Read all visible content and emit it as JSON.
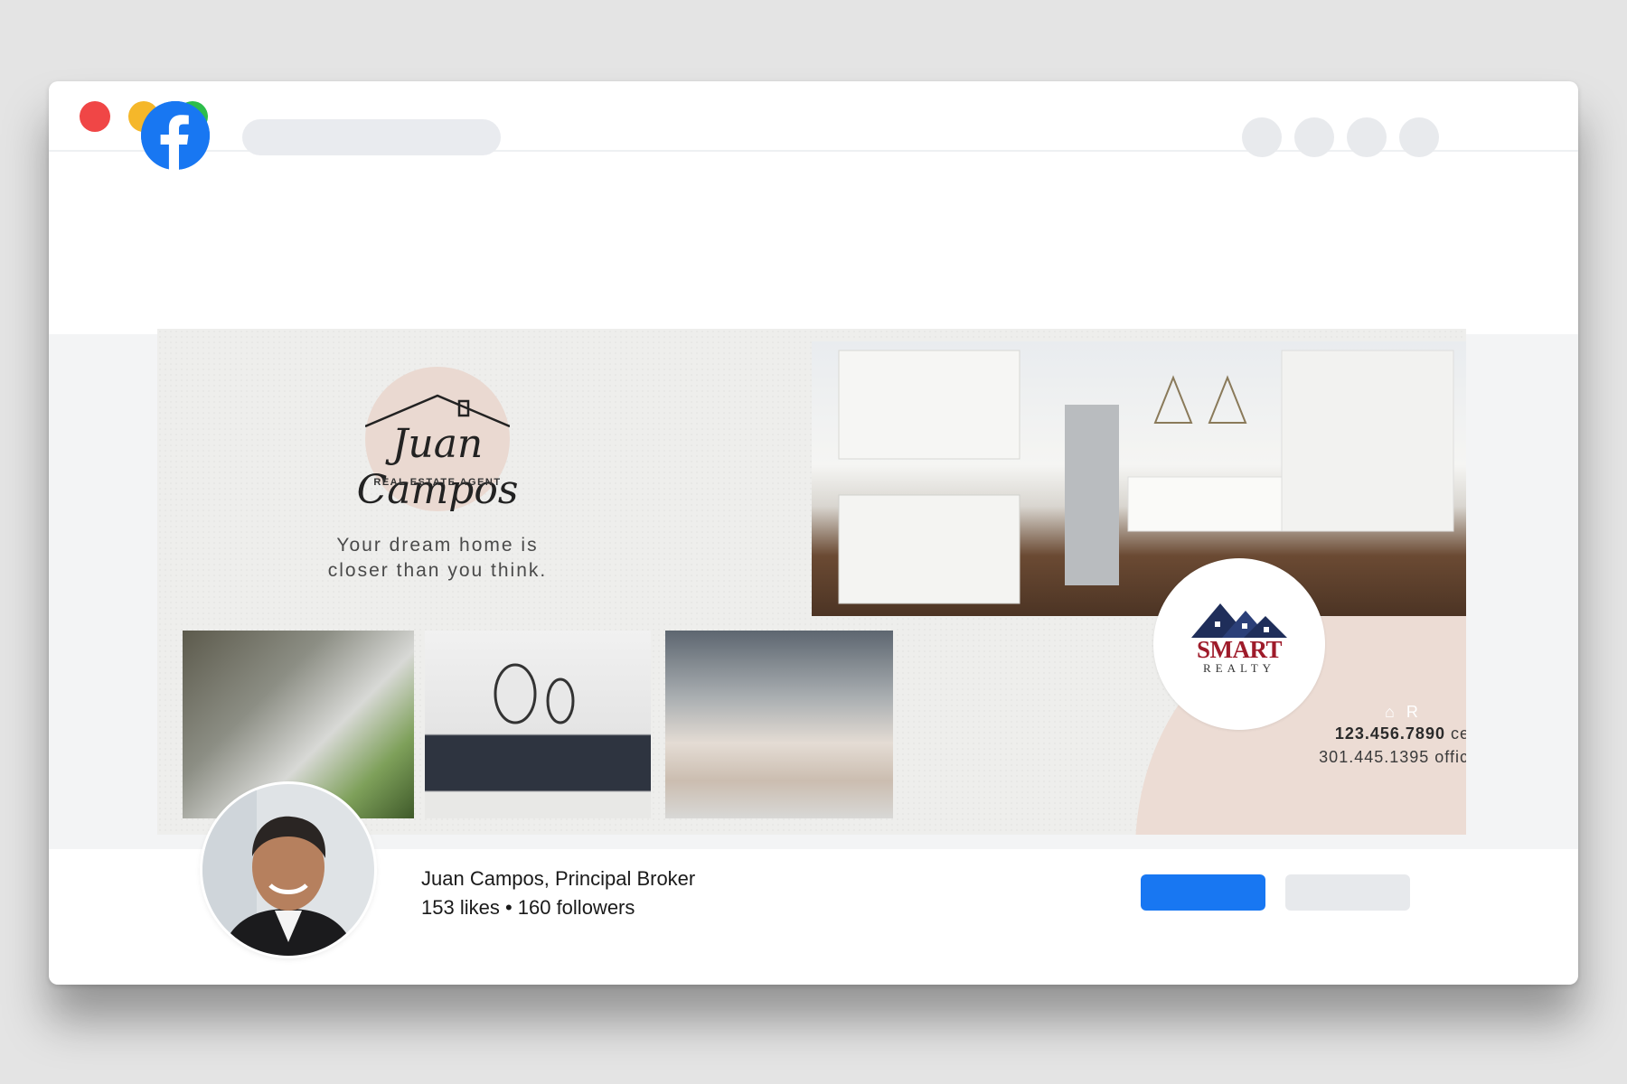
{
  "browser": {
    "controls": [
      "close",
      "minimize",
      "maximize"
    ]
  },
  "facebook": {
    "logo_icon": "facebook-logo-icon",
    "brand_color": "#1877f2"
  },
  "cover": {
    "logo": {
      "name": "Juan Campos",
      "subtitle": "REAL ESTATE AGENT"
    },
    "tagline": "Your dream home is\ncloser than you think.",
    "brokerage": {
      "name": "SMART",
      "sub": "REALTY",
      "color": "#9e1b2a"
    },
    "equal_housing_icons": "⌂ R",
    "contact": {
      "cell_number": "123.456.7890",
      "cell_label": "cell",
      "office_number": "301.445.1395",
      "office_label": "office"
    }
  },
  "profile": {
    "name": "Juan Campos, Principal Broker",
    "stats": "153 likes • 160 followers"
  }
}
